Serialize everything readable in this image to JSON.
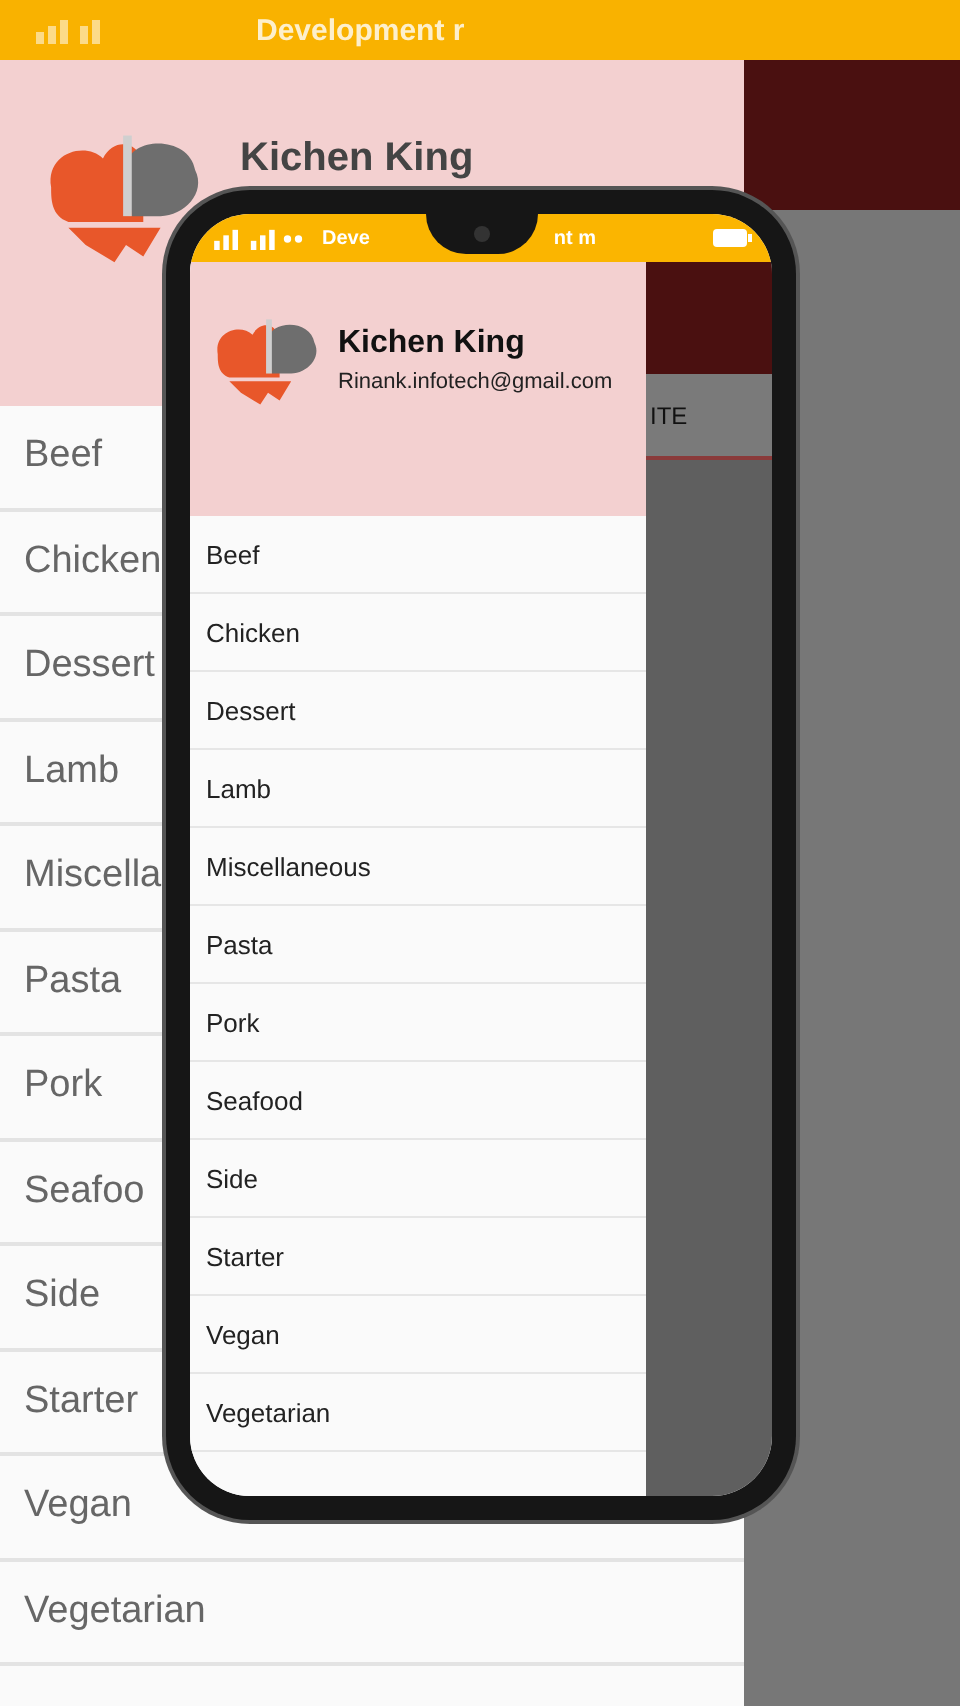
{
  "background": {
    "status_text": "Development r",
    "app_title": "Kichen King",
    "categories": [
      "Beef",
      "Chicken",
      "Dessert",
      "Lamb",
      "Miscella",
      "Pasta",
      "Pork",
      "Seafoo",
      "Side",
      "Starter",
      "Vegan",
      "Vegetarian"
    ]
  },
  "phone": {
    "status_left": "Deve",
    "status_right": "nt m",
    "behind_tab": "ITE",
    "drawer": {
      "title": "Kichen King",
      "email": "Rinank.infotech@gmail.com",
      "categories": [
        "Beef",
        "Chicken",
        "Dessert",
        "Lamb",
        "Miscellaneous",
        "Pasta",
        "Pork",
        "Seafood",
        "Side",
        "Starter",
        "Vegan",
        "Vegetarian"
      ]
    }
  }
}
